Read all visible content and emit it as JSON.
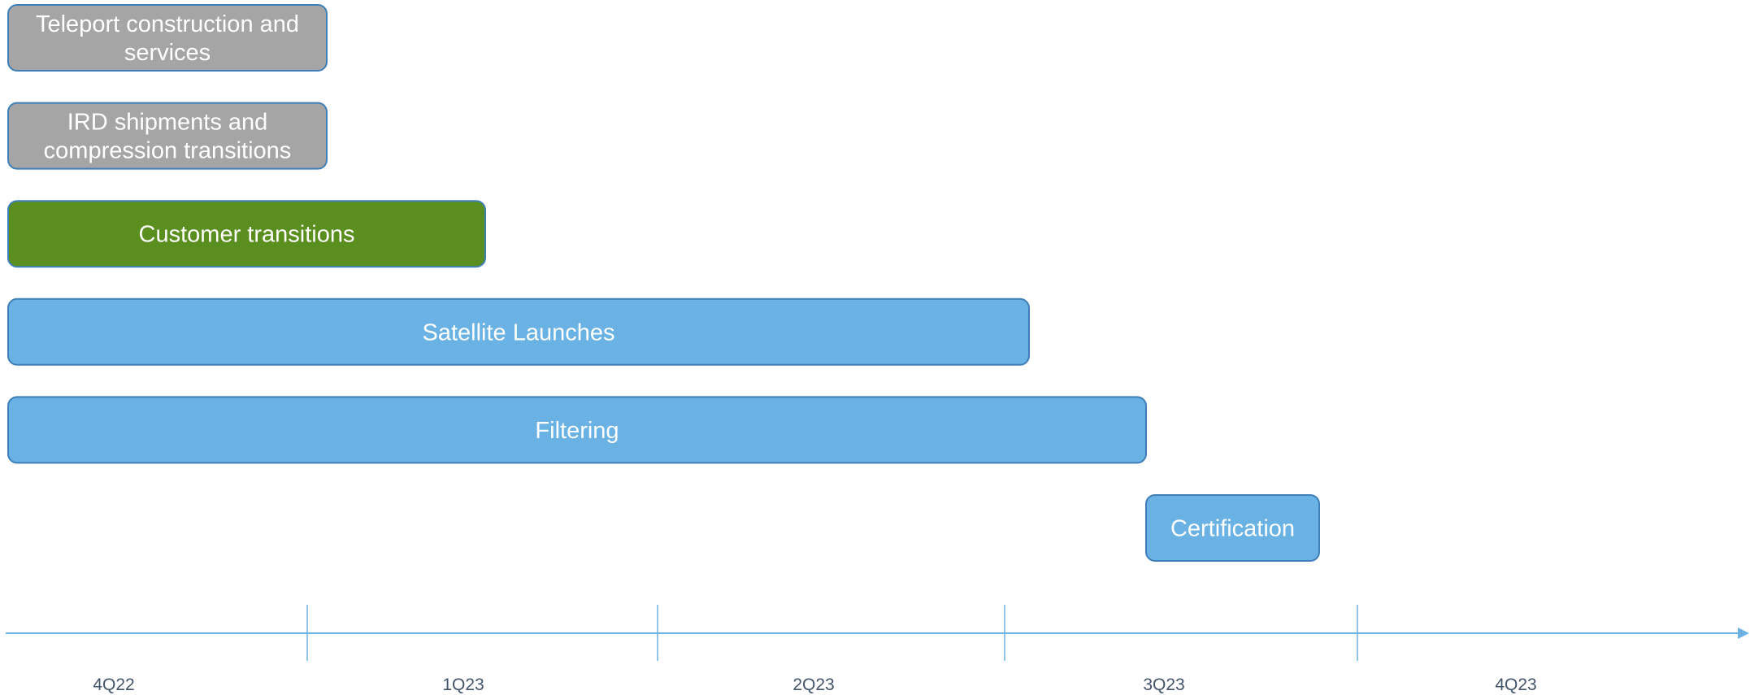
{
  "chart_data": {
    "type": "gantt",
    "title": "",
    "xlabel": "",
    "ylabel": "",
    "x_categories": [
      "4Q22",
      "1Q23",
      "2Q23",
      "3Q23",
      "4Q23"
    ],
    "tasks": [
      {
        "label": [
          "Teleport construction and",
          "services"
        ],
        "start": "4Q22",
        "end": "4Q22 end",
        "status": "complete",
        "color": "#a5a5a5"
      },
      {
        "label": [
          "IRD shipments and",
          "compression transitions"
        ],
        "start": "4Q22",
        "end": "4Q22 end",
        "status": "complete",
        "color": "#a5a5a5"
      },
      {
        "label": [
          "Customer transitions"
        ],
        "start": "4Q22",
        "end": "early 1Q23",
        "status": "in progress",
        "color": "#5a8e1e"
      },
      {
        "label": [
          "Satellite Launches"
        ],
        "start": "4Q22",
        "end": "late 2Q23",
        "status": "planned",
        "color": "#6ab1e4"
      },
      {
        "label": [
          "Filtering"
        ],
        "start": "4Q22",
        "end": "early 3Q23",
        "status": "planned",
        "color": "#6ab1e4"
      },
      {
        "label": [
          "Certification"
        ],
        "start": "early 3Q23",
        "end": "mid 3Q23",
        "status": "planned",
        "color": "#6ab1e4"
      }
    ],
    "colors": {
      "complete": "#a5a5a5",
      "in_progress": "#5a8e1e",
      "planned": "#6ab1e4",
      "bar_border": "#3e7fb8",
      "axis": "#6ab1e4",
      "tick_label": "#44546a"
    },
    "grid": false,
    "legend": "none"
  }
}
